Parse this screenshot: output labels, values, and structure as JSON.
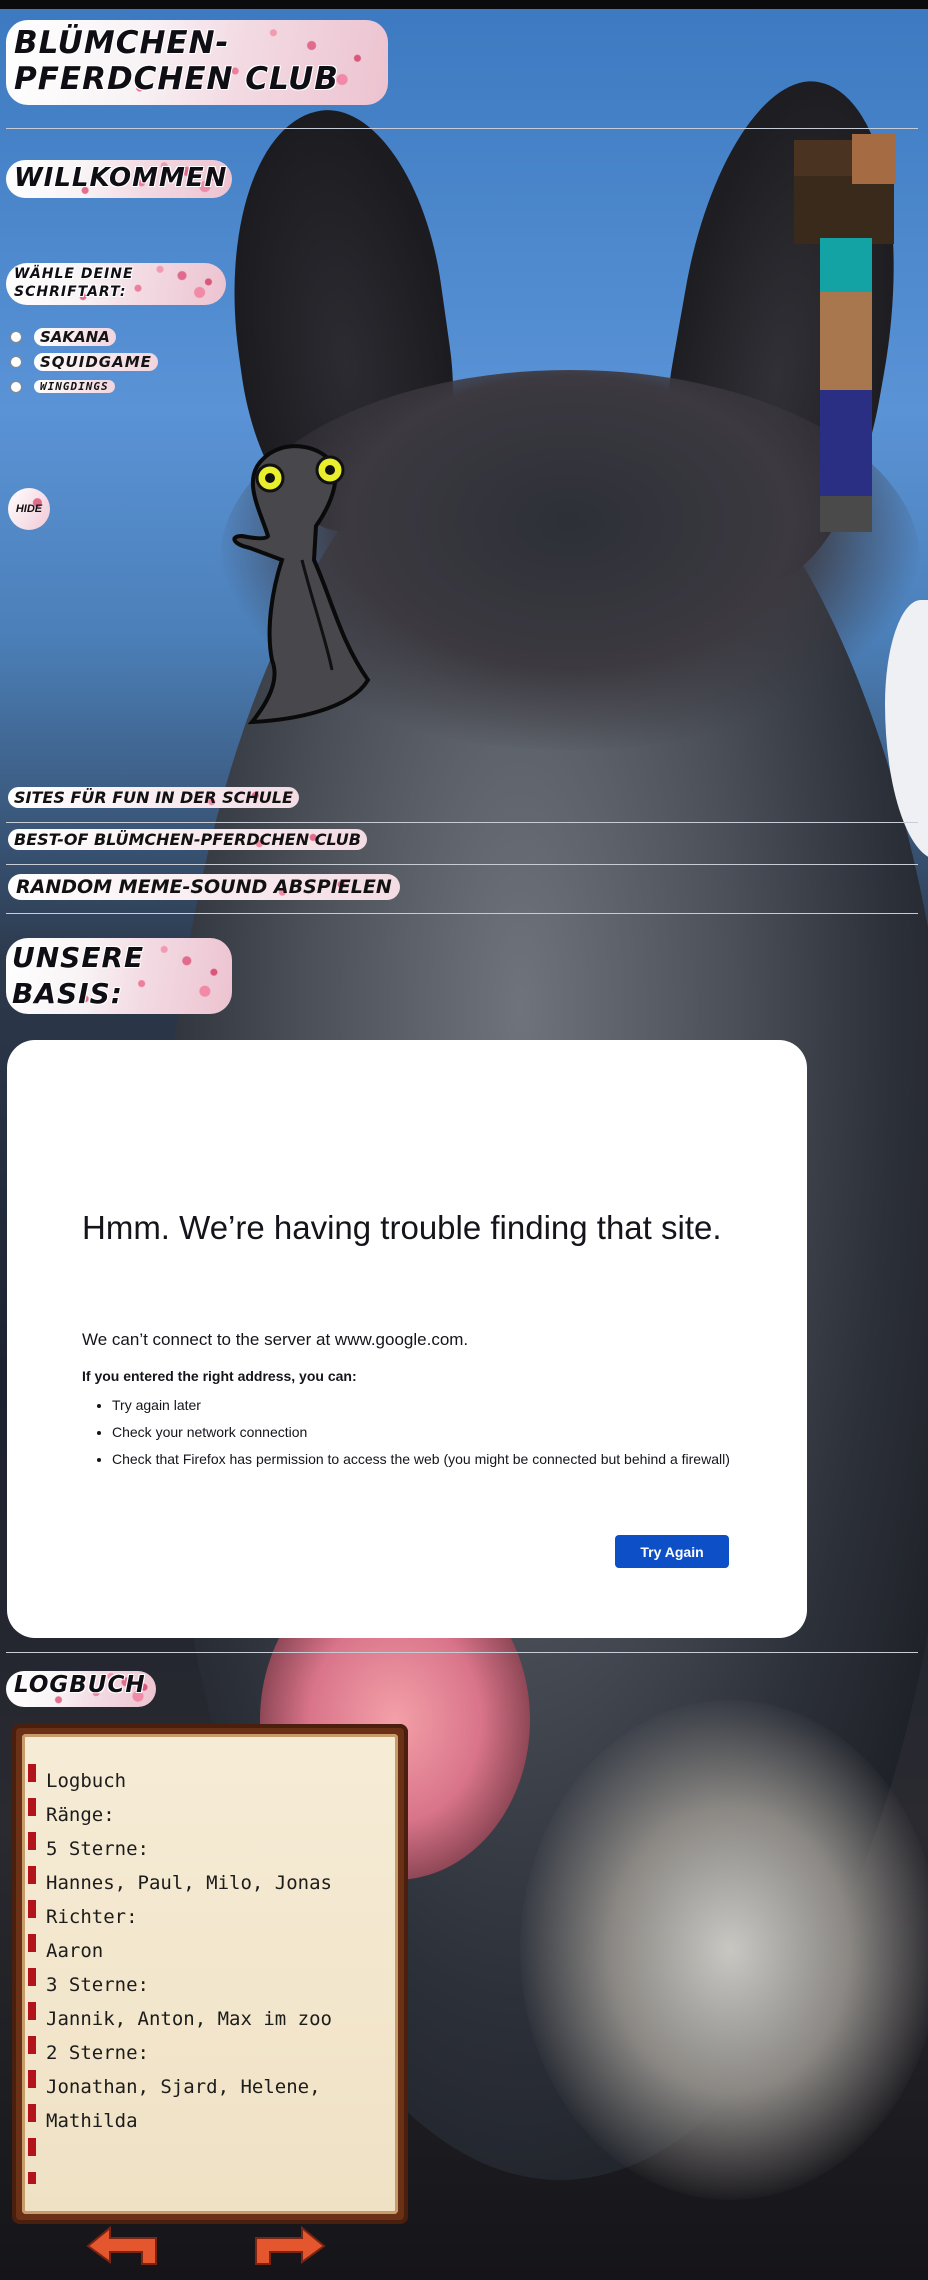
{
  "site": {
    "title": "BLÜMCHEN-PFERDCHEN CLUB",
    "welcome": "WILLKOMMEN",
    "font_prompt": "WÄHLE DEINE SCHRIFTART:"
  },
  "font_options": [
    "SAKANA",
    "SQUIDGAME",
    "WINGDINGS"
  ],
  "hide_button": "HIDE",
  "nav": {
    "link1": "SITES FÜR FUN IN DER SCHULE",
    "link2": "BEST-OF BLÜMCHEN-PFERDCHEN CLUB",
    "link3": "RANDOM MEME-SOUND ABSPIELEN"
  },
  "basis_heading": "UNSERE BASIS:",
  "error_page": {
    "title": "Hmm. We’re having trouble finding that site.",
    "subtitle": "We can’t connect to the server at www.google.com.",
    "hint": "If you entered the right address, you can:",
    "items": [
      "Try again later",
      "Check your network connection",
      "Check that Firefox has permission to access the web (you might be connected but behind a firewall)"
    ],
    "button": "Try Again"
  },
  "logbuch_heading": "LOGBUCH",
  "logbook_lines": [
    "Logbuch",
    "Ränge:",
    "5 Sterne:",
    "Hannes, Paul, Milo, Jonas",
    "Richter:",
    "Aaron",
    "3 Sterne:",
    "Jannik, Anton, Max im zoo",
    "2 Sterne:",
    "Jonathan, Sjard, Helene,",
    "Mathilda"
  ],
  "colors": {
    "accent_pink": "#e06b8c",
    "button_blue": "#0d4fc7",
    "book_brown": "#6b3117",
    "arrow_orange": "#e4572e"
  },
  "icons": [
    "cherry-blossom-panel",
    "steve-figure",
    "lizard-drawing",
    "page-prev-arrow",
    "page-next-arrow"
  ]
}
